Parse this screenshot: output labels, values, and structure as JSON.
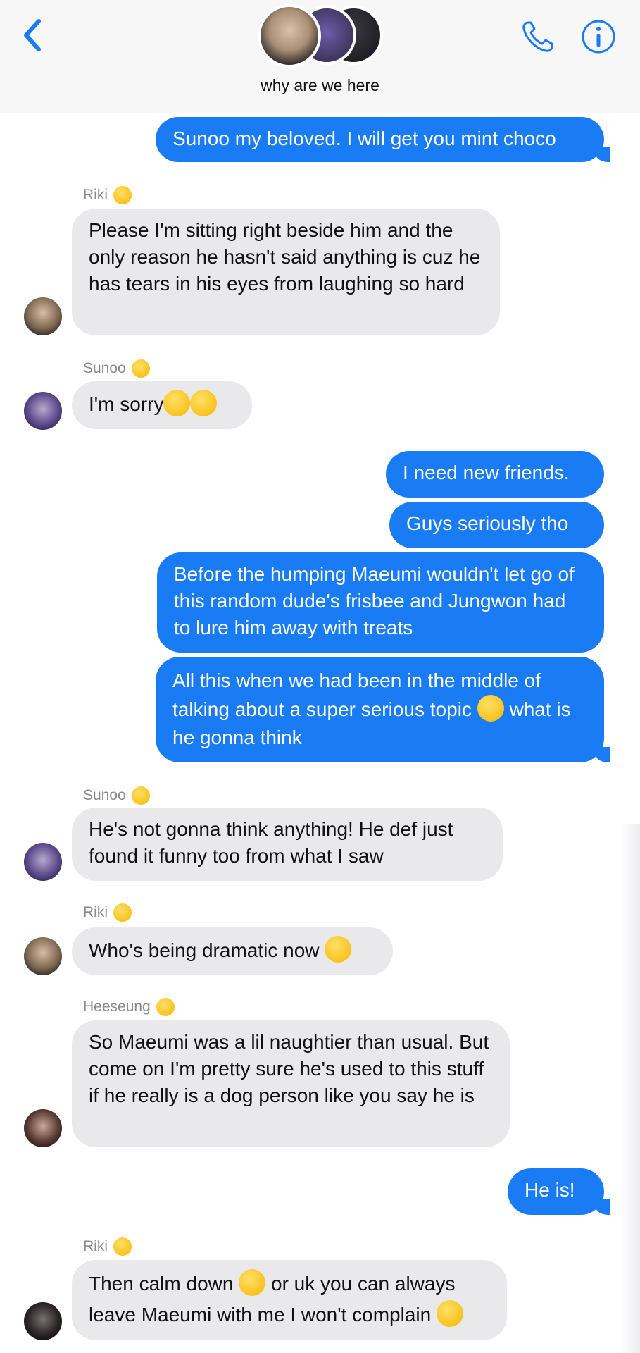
{
  "header": {
    "group_name": "why are we here",
    "icons": [
      "chevron-left-icon",
      "phone-icon",
      "info-icon"
    ]
  },
  "colors": {
    "outgoing": "#1a7cf5",
    "incoming": "#e9e9eb",
    "accent": "#1a7cf5"
  },
  "messages": [
    {
      "dir": "out",
      "text": "Sunoo my beloved. I will get you mint choco"
    },
    {
      "dir": "in",
      "sender": "Riki",
      "text": "Please I'm sitting right beside him and the only reason he hasn't said anything is cuz he has tears in his eyes from laughing so hard"
    },
    {
      "dir": "in",
      "sender": "Sunoo",
      "text": "I'm sorry"
    },
    {
      "dir": "out",
      "text": "I need new friends."
    },
    {
      "dir": "out",
      "text": "Guys seriously tho"
    },
    {
      "dir": "out",
      "text": "Before the humping Maeumi wouldn't let go of this random dude's frisbee and Jungwon had to lure him away with treats"
    },
    {
      "dir": "out",
      "text_a": "All this when we had been in the middle of talking about a super serious topic",
      "text_b": "what is he gonna think"
    },
    {
      "dir": "in",
      "sender": "Sunoo",
      "text": "He's not gonna think anything! He def just found it funny too from what I saw"
    },
    {
      "dir": "in",
      "sender": "Riki",
      "text": "Who's being dramatic now"
    },
    {
      "dir": "in",
      "sender": "Heeseung",
      "text": "So Maeumi was a lil naughtier than usual. But come on I'm pretty sure he's used to this stuff if he really is a dog person like you say he is"
    },
    {
      "dir": "out",
      "text": "He is!"
    },
    {
      "dir": "in",
      "sender": "Riki",
      "text_a": "Then calm down",
      "text_b": "or uk you can always leave Maeumi with me I won't complain"
    }
  ]
}
